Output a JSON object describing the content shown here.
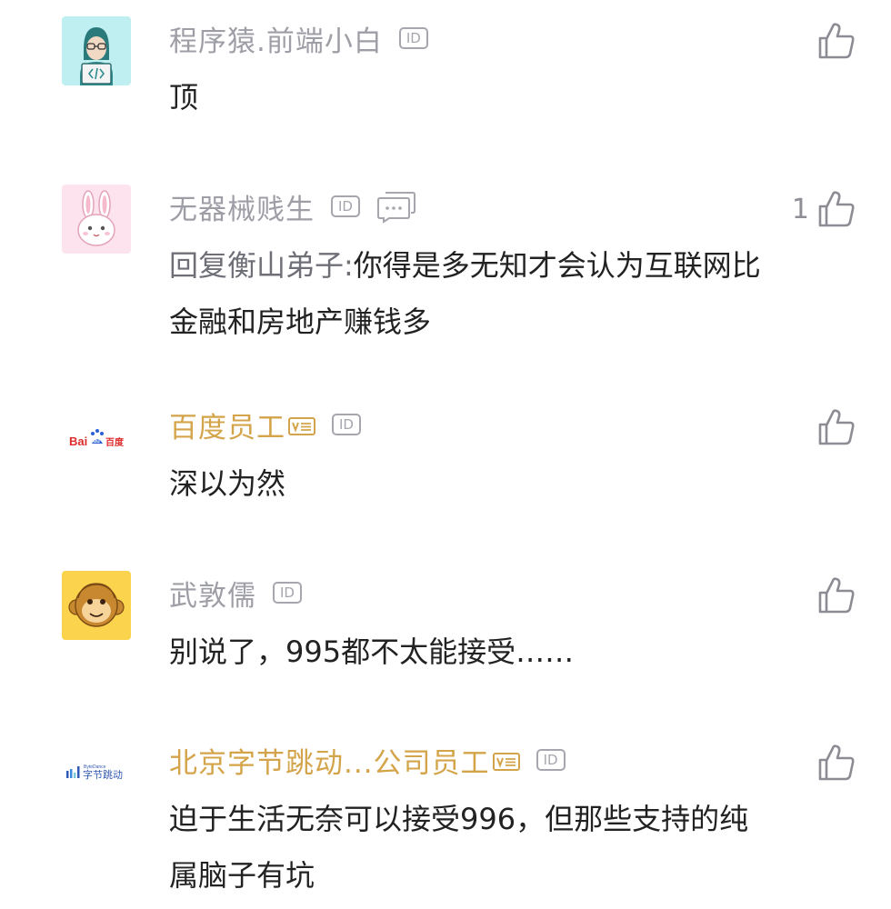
{
  "comments": [
    {
      "username": "程序猿.前端小白",
      "id_badge": "ID",
      "content": "顶",
      "likes": "",
      "avatar": "coder-avatar"
    },
    {
      "username": "无器械贱生",
      "id_badge": "ID",
      "reply_prefix": "回复衡山弟子:",
      "content": "你得是多无知才会认为互联网比金融和房地产赚钱多",
      "likes": "1",
      "avatar": "rabbit-avatar"
    },
    {
      "username": "百度员工",
      "id_badge": "ID",
      "content": "深以为然",
      "likes": "",
      "avatar": "baidu-logo",
      "logo_text_a": "Bai",
      "logo_text_b": "du",
      "logo_text_c": "百度"
    },
    {
      "username": "武敦儒",
      "id_badge": "ID",
      "content": "别说了，995都不太能接受……",
      "likes": "",
      "avatar": "monkey-avatar"
    },
    {
      "username": "北京字节跳动...公司员工",
      "id_badge": "ID",
      "content": "迫于生活无奈可以接受996，但那些支持的纯属脑子有坑",
      "likes": "",
      "avatar": "bytedance-logo",
      "logo_text_a": "ByteDance",
      "logo_text_b": "字节跳动"
    }
  ],
  "colors": {
    "username": "#9e9ea6",
    "employee_name": "#d4a44a",
    "content": "#222222",
    "icon": "#8c8c94"
  }
}
